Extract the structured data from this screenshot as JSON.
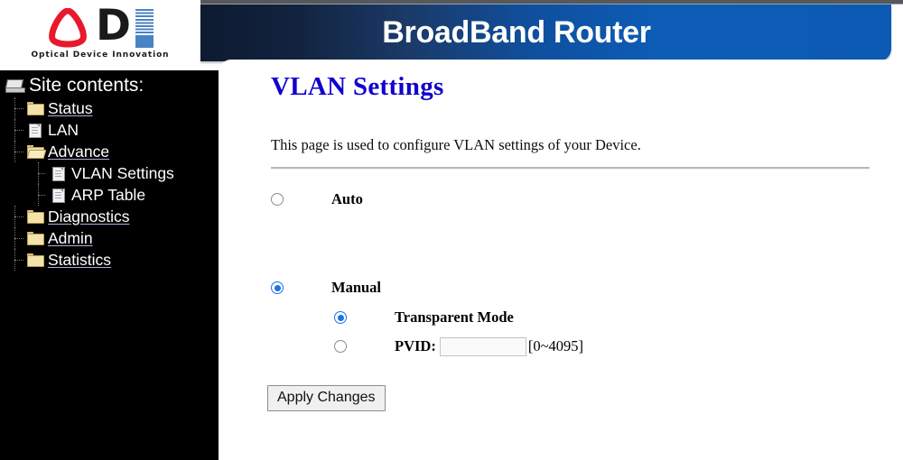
{
  "brand": {
    "logo_letters": "D",
    "tagline": "Optical Device Innovation"
  },
  "header": {
    "title": "BroadBand Router",
    "gradient_start": "#0d1a30",
    "gradient_end": "#0d5cb6"
  },
  "sidebar": {
    "heading": "Site contents:",
    "background": "#000000",
    "items": [
      {
        "label": "Status",
        "icon": "folder-icon",
        "level": 0,
        "is_link": true
      },
      {
        "label": "LAN",
        "icon": "document-icon",
        "level": 0,
        "is_link": false
      },
      {
        "label": "Advance",
        "icon": "folder-open-icon",
        "level": 0,
        "is_link": true
      },
      {
        "label": "VLAN Settings",
        "icon": "document-icon",
        "level": 1,
        "is_link": false
      },
      {
        "label": "ARP Table",
        "icon": "document-icon",
        "level": 1,
        "is_link": false
      },
      {
        "label": "Diagnostics",
        "icon": "folder-icon",
        "level": 0,
        "is_link": true
      },
      {
        "label": "Admin",
        "icon": "folder-icon",
        "level": 0,
        "is_link": true
      },
      {
        "label": "Statistics",
        "icon": "folder-icon",
        "level": 0,
        "is_link": true
      }
    ]
  },
  "main": {
    "title": "VLAN Settings",
    "title_color": "#1000ce",
    "description": "This page is used to configure VLAN settings of your Device.",
    "options": {
      "auto_label": "Auto",
      "auto_checked": false,
      "manual_label": "Manual",
      "manual_checked": true,
      "transparent_label": "Transparent Mode",
      "transparent_checked": true,
      "pvid_label": "PVID:",
      "pvid_checked": false,
      "pvid_value": "",
      "pvid_placeholder": "",
      "pvid_hint": "[0~4095]"
    },
    "apply_label": "Apply Changes"
  }
}
